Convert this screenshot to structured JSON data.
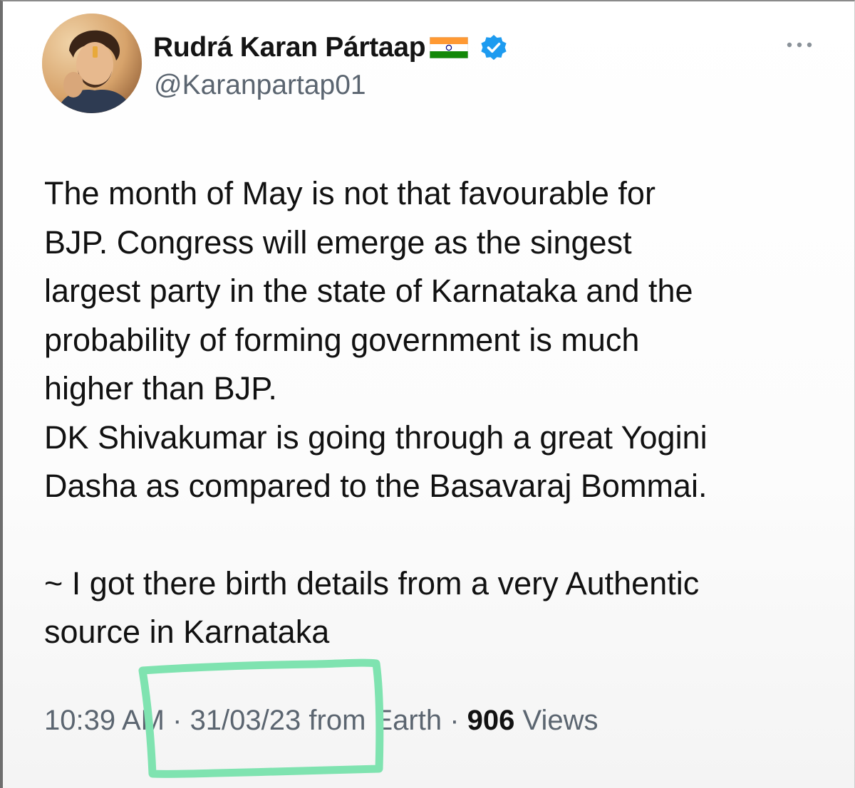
{
  "tweet": {
    "author": {
      "display_name": "Rudrá Karan Pártaap",
      "handle": "@Karanpartap01",
      "flag_icon": "india-flag-icon",
      "verified_icon": "verified-badge-icon",
      "verified_color": "#1d9bf0"
    },
    "more_icon": "more-options-icon",
    "body": {
      "paragraph_1": "The month of May is not that favourable for\nBJP. Congress will emerge as the singest\nlargest party in the state of Karnataka and the\nprobability of forming government is much\nhigher than BJP.\nDK Shivakumar is going through a great Yogini\nDasha as compared to the Basavaraj Bommai.",
      "paragraph_2": "~ I got there birth details from a very Authentic\nsource in Karnataka"
    },
    "meta": {
      "time": "10:39 AM",
      "separator": " · ",
      "date": "31/03/23",
      "source": "from Earth",
      "views_count": "906",
      "views_label": "Views"
    }
  },
  "annotation": {
    "highlight_color": "#7fe3b0",
    "highlight_target": "date-and-source"
  }
}
